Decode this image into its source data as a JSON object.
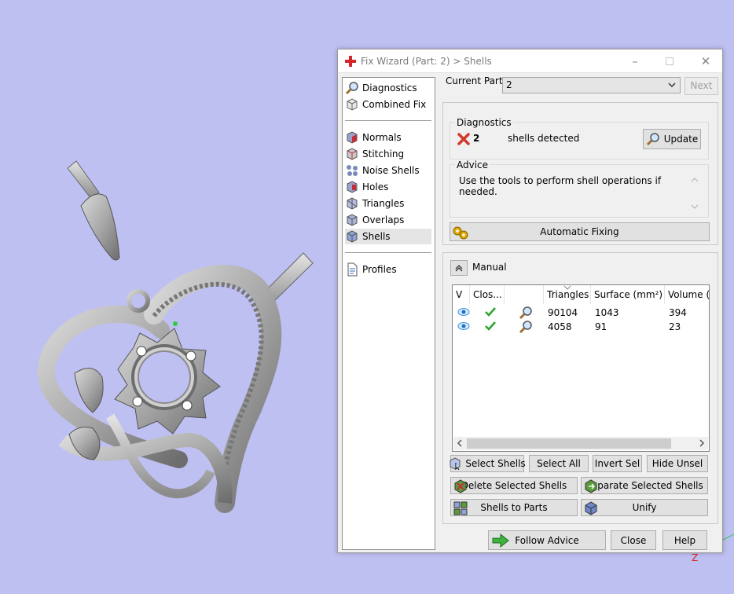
{
  "window": {
    "title": "Fix Wizard (Part: 2) > Shells",
    "minimize_icon": "minimize-icon",
    "maximize_icon": "maximize-icon",
    "close_icon": "close-icon"
  },
  "nav": {
    "top": [
      {
        "label": "Diagnostics",
        "icon": "magnifier-icon"
      },
      {
        "label": "Combined Fix",
        "icon": "cube-icon"
      }
    ],
    "tools": [
      {
        "label": "Normals",
        "icon": "normals-cube-icon"
      },
      {
        "label": "Stitching",
        "icon": "stitching-cube-icon"
      },
      {
        "label": "Noise Shells",
        "icon": "noise-shells-icon"
      },
      {
        "label": "Holes",
        "icon": "holes-cube-icon"
      },
      {
        "label": "Triangles",
        "icon": "triangles-cube-icon"
      },
      {
        "label": "Overlaps",
        "icon": "overlaps-cube-icon"
      },
      {
        "label": "Shells",
        "icon": "shells-cube-icon",
        "selected": true
      }
    ],
    "bottom": [
      {
        "label": "Profiles",
        "icon": "document-icon"
      }
    ]
  },
  "current_part": {
    "label": "Current Part:",
    "value": "2",
    "next_label": "Next"
  },
  "diagnostics": {
    "group_title": "Diagnostics",
    "count": "2",
    "text": "shells detected",
    "update_label": "Update",
    "status_color": "#d13a2b"
  },
  "advice": {
    "group_title": "Advice",
    "text": "Use the tools to perform shell operations if needed.",
    "auto_fix_label": "Automatic Fixing"
  },
  "manual": {
    "label": "Manual",
    "columns": [
      "V",
      "Clos...",
      "",
      "Triangles",
      "Surface (mm²)",
      "Volume ("
    ],
    "rows": [
      {
        "triangles": "90104",
        "surface": "1043",
        "volume": "394"
      },
      {
        "triangles": "4058",
        "surface": "91",
        "volume": "23"
      }
    ],
    "buttons": {
      "select_shells": "Select Shells",
      "select_all": "Select All",
      "invert_sel": "Invert Sel",
      "hide_unsel": "Hide Unsel",
      "delete_selected": "Delete Selected Shells",
      "separate_selected": "Separate Selected Shells",
      "shells_to_parts": "Shells to Parts",
      "unify": "Unify"
    }
  },
  "footer": {
    "follow_advice": "Follow Advice",
    "close": "Close",
    "help": "Help"
  },
  "viewport": {
    "axis_label": "Z",
    "background_color": "#bfc0f2"
  }
}
